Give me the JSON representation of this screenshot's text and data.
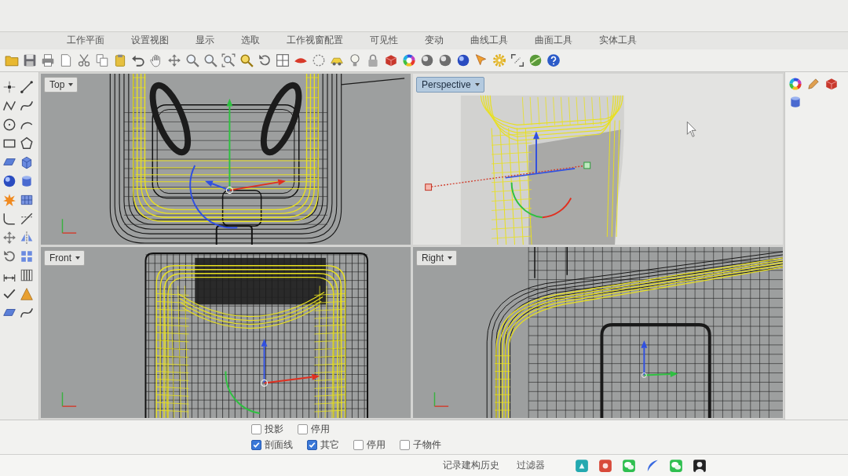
{
  "toolbar_tabs": [
    {
      "label": "工作平面",
      "selected": false
    },
    {
      "label": "设置视图",
      "selected": false
    },
    {
      "label": "显示",
      "selected": false
    },
    {
      "label": "选取",
      "selected": false
    },
    {
      "label": "工作视窗配置",
      "selected": false
    },
    {
      "label": "可见性",
      "selected": false
    },
    {
      "label": "变动",
      "selected": false
    },
    {
      "label": "曲线工具",
      "selected": false
    },
    {
      "label": "曲面工具",
      "selected": false
    },
    {
      "label": "实体工具",
      "selected": false
    }
  ],
  "viewports": [
    {
      "title": "Top",
      "kind": "top",
      "selected": false
    },
    {
      "title": "Perspective",
      "kind": "perspective",
      "selected": true
    },
    {
      "title": "Front",
      "kind": "front",
      "selected": false
    },
    {
      "title": "Right",
      "kind": "right",
      "selected": false
    }
  ],
  "osnap": [
    {
      "label": "投影",
      "checked": false
    },
    {
      "label": "停用",
      "checked": false
    }
  ],
  "selection_filter": [
    {
      "label": "剖面线",
      "checked": true
    },
    {
      "label": "其它",
      "checked": true
    },
    {
      "label": "停用",
      "checked": false
    },
    {
      "label": "子物件",
      "checked": false
    }
  ],
  "status_bar": {
    "items": [
      "记录建构历史",
      "过滤器"
    ]
  }
}
